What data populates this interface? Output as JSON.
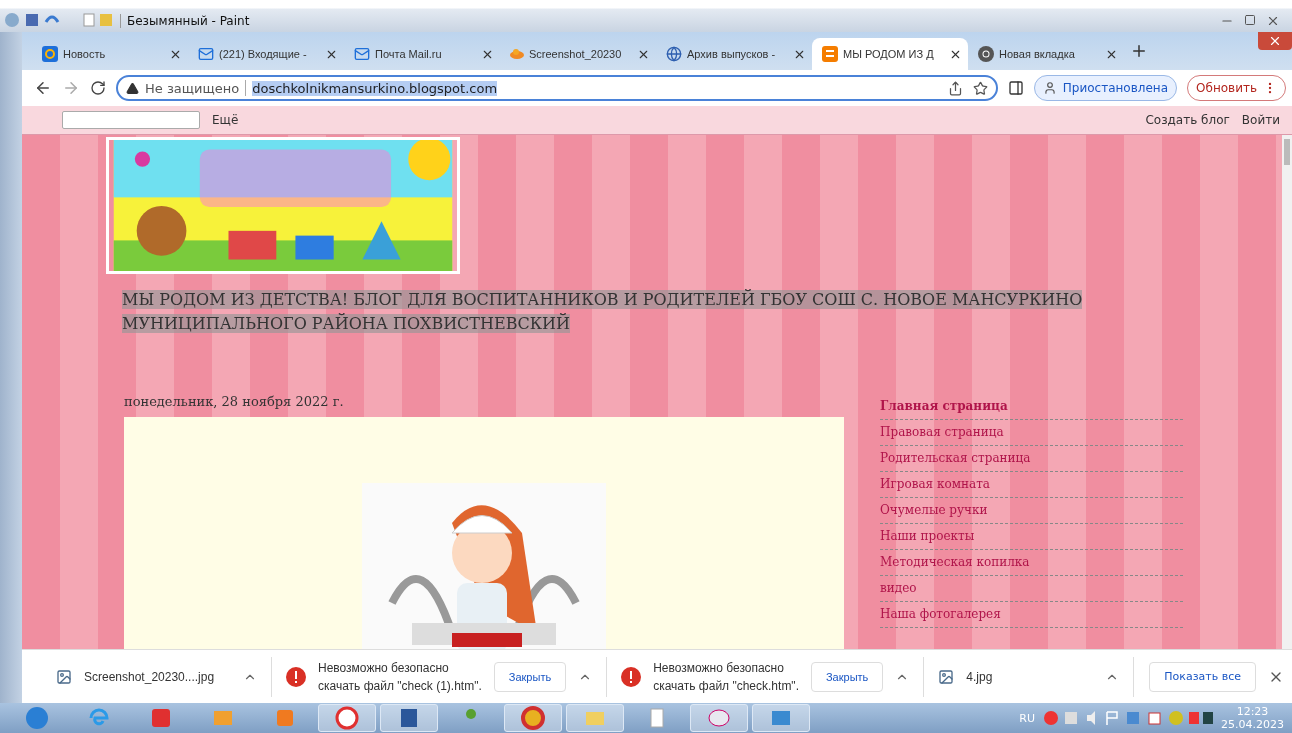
{
  "paint": {
    "title": "Безымянный - Paint"
  },
  "tabs": [
    {
      "label": "Новость",
      "selected": false
    },
    {
      "label": "(221) Входящие -",
      "selected": false
    },
    {
      "label": "Почта Mail.ru",
      "selected": false
    },
    {
      "label": "Screenshot_20230",
      "selected": false
    },
    {
      "label": "Архив выпусков -",
      "selected": false
    },
    {
      "label": "МЫ РОДОМ ИЗ Д",
      "selected": true
    },
    {
      "label": "Новая вкладка",
      "selected": false
    }
  ],
  "address": {
    "security": "Не защищено",
    "url": "doschkolnikmansurkino.blogspot.com",
    "profile": "Приостановлена",
    "update": "Обновить"
  },
  "navbar": {
    "more": "Ещё",
    "create": "Создать блог",
    "login": "Войти"
  },
  "blog": {
    "title": "МЫ РОДОМ ИЗ ДЕТСТВА! БЛОГ ДЛЯ ВОСПИТАННИКОВ И РОДИТЕЛЕЙ ГБОУ СОШ С. НОВОЕ МАНСУРКИНО МУНИЦИПАЛЬНОГО РАЙОНА ПОХВИСТНЕВСКИЙ",
    "date": "понедельник, 28 ноября 2022 г.",
    "pages": [
      {
        "label": "Главная страница",
        "selected": true
      },
      {
        "label": "Правовая страница",
        "selected": false
      },
      {
        "label": "Родительская страница",
        "selected": false
      },
      {
        "label": "Игровая комната",
        "selected": false
      },
      {
        "label": "Очумелые ручки",
        "selected": false
      },
      {
        "label": "Наши проекты",
        "selected": false
      },
      {
        "label": "Методическая копилка",
        "selected": false
      },
      {
        "label": "видео",
        "selected": false
      },
      {
        "label": "Наша фотогалерея",
        "selected": false
      }
    ]
  },
  "downloads": {
    "items": [
      {
        "kind": "file",
        "name": "Screenshot_20230....jpg"
      },
      {
        "kind": "warning",
        "lines": [
          "Невозможно безопасно",
          "скачать файл \"check (1).htm\"."
        ],
        "action": "Закрыть"
      },
      {
        "kind": "warning",
        "lines": [
          "Невозможно безопасно",
          "скачать файл \"check.htm\"."
        ],
        "action": "Закрыть"
      },
      {
        "kind": "file",
        "name": "4.jpg"
      }
    ],
    "show_all": "Показать все"
  },
  "taskbar": {
    "language": "RU",
    "time": "12:23",
    "date": "25.04.2023"
  }
}
